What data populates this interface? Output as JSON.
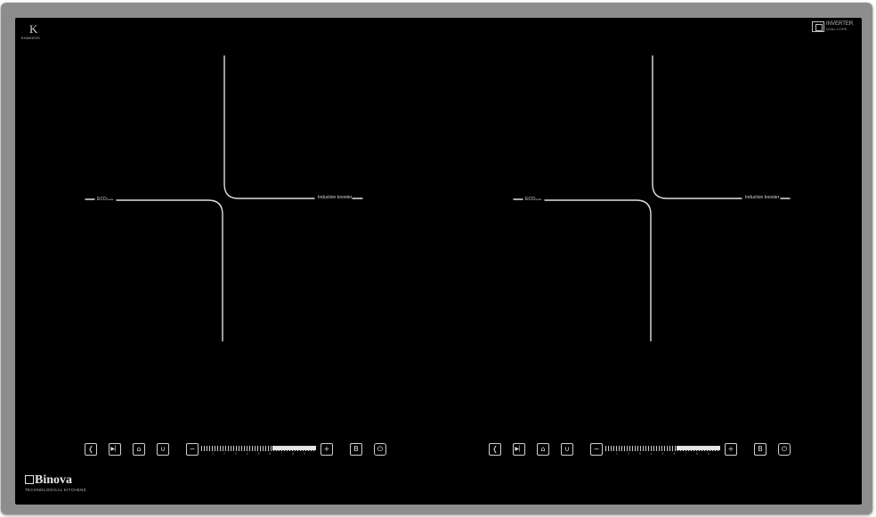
{
  "product": {
    "brand_mark": "K",
    "brand_word": "KHAKESS",
    "inverter_title": "INVERTER",
    "inverter_sub": "DUAL-CORE",
    "footer_brand": "Binova",
    "footer_tagline": "TECHNOLOGICAL KITCHENS"
  },
  "zones": [
    {
      "eco_label": "ECO",
      "eco_sub": "mode",
      "booster_label": "Induction booster"
    },
    {
      "eco_label": "ECO",
      "eco_sub": "mode",
      "booster_label": "Induction booster"
    }
  ],
  "controls": [
    {
      "back_glyph": "❬",
      "skip_glyph": "▶▏",
      "lock_glyph": "⌂",
      "pan_glyph": "∪",
      "minus_glyph": "−",
      "plus_glyph": "+",
      "boost_label": "B",
      "power_glyph": "⏻",
      "slider_numbers": [
        "1",
        "2",
        "3",
        "4",
        "5",
        "6",
        "7",
        "8",
        "9"
      ],
      "slider_level": 0.62
    },
    {
      "back_glyph": "❬",
      "skip_glyph": "▶▏",
      "lock_glyph": "⌂",
      "pan_glyph": "∪",
      "minus_glyph": "−",
      "plus_glyph": "+",
      "boost_label": "B",
      "power_glyph": "⏻",
      "slider_numbers": [
        "1",
        "2",
        "3",
        "4",
        "5",
        "6",
        "7",
        "8",
        "9"
      ],
      "slider_level": 0.62
    }
  ],
  "colors": {
    "glass": "#000000",
    "frame": "#8d8d8d",
    "markings": "#e0e0e0"
  }
}
